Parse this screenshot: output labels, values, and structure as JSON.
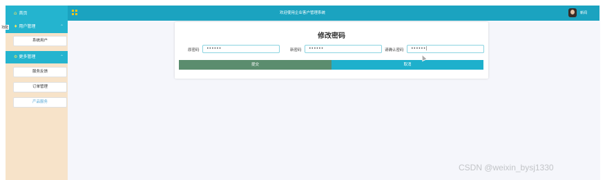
{
  "topbar": {
    "home_label": "首页",
    "title": "欢迎使用企业客户管理系统",
    "user_name": "新闻"
  },
  "sidebar": {
    "floating_label": "功能",
    "groups": [
      {
        "label": "用户管理",
        "items": [
          {
            "label": "系统用户"
          }
        ]
      },
      {
        "label": "更多管理",
        "items": [
          {
            "label": "服务反馈"
          },
          {
            "label": "订单管理"
          },
          {
            "label": "产品服务"
          }
        ]
      }
    ]
  },
  "form": {
    "title": "修改密码",
    "fields": [
      {
        "label": "原密码",
        "value": "••••••"
      },
      {
        "label": "新密码",
        "value": "••••••"
      },
      {
        "label": "请确认密码",
        "value": "••••••|"
      }
    ],
    "submit_label": "提交",
    "cancel_label": "取消"
  },
  "watermark": "CSDN @weixin_bysj1330",
  "colors": {
    "topbar": "#1ba3c0",
    "sidebar_bg": "#f7e3c9",
    "submit": "#5b8d6e",
    "cancel": "#1eb0cc"
  }
}
